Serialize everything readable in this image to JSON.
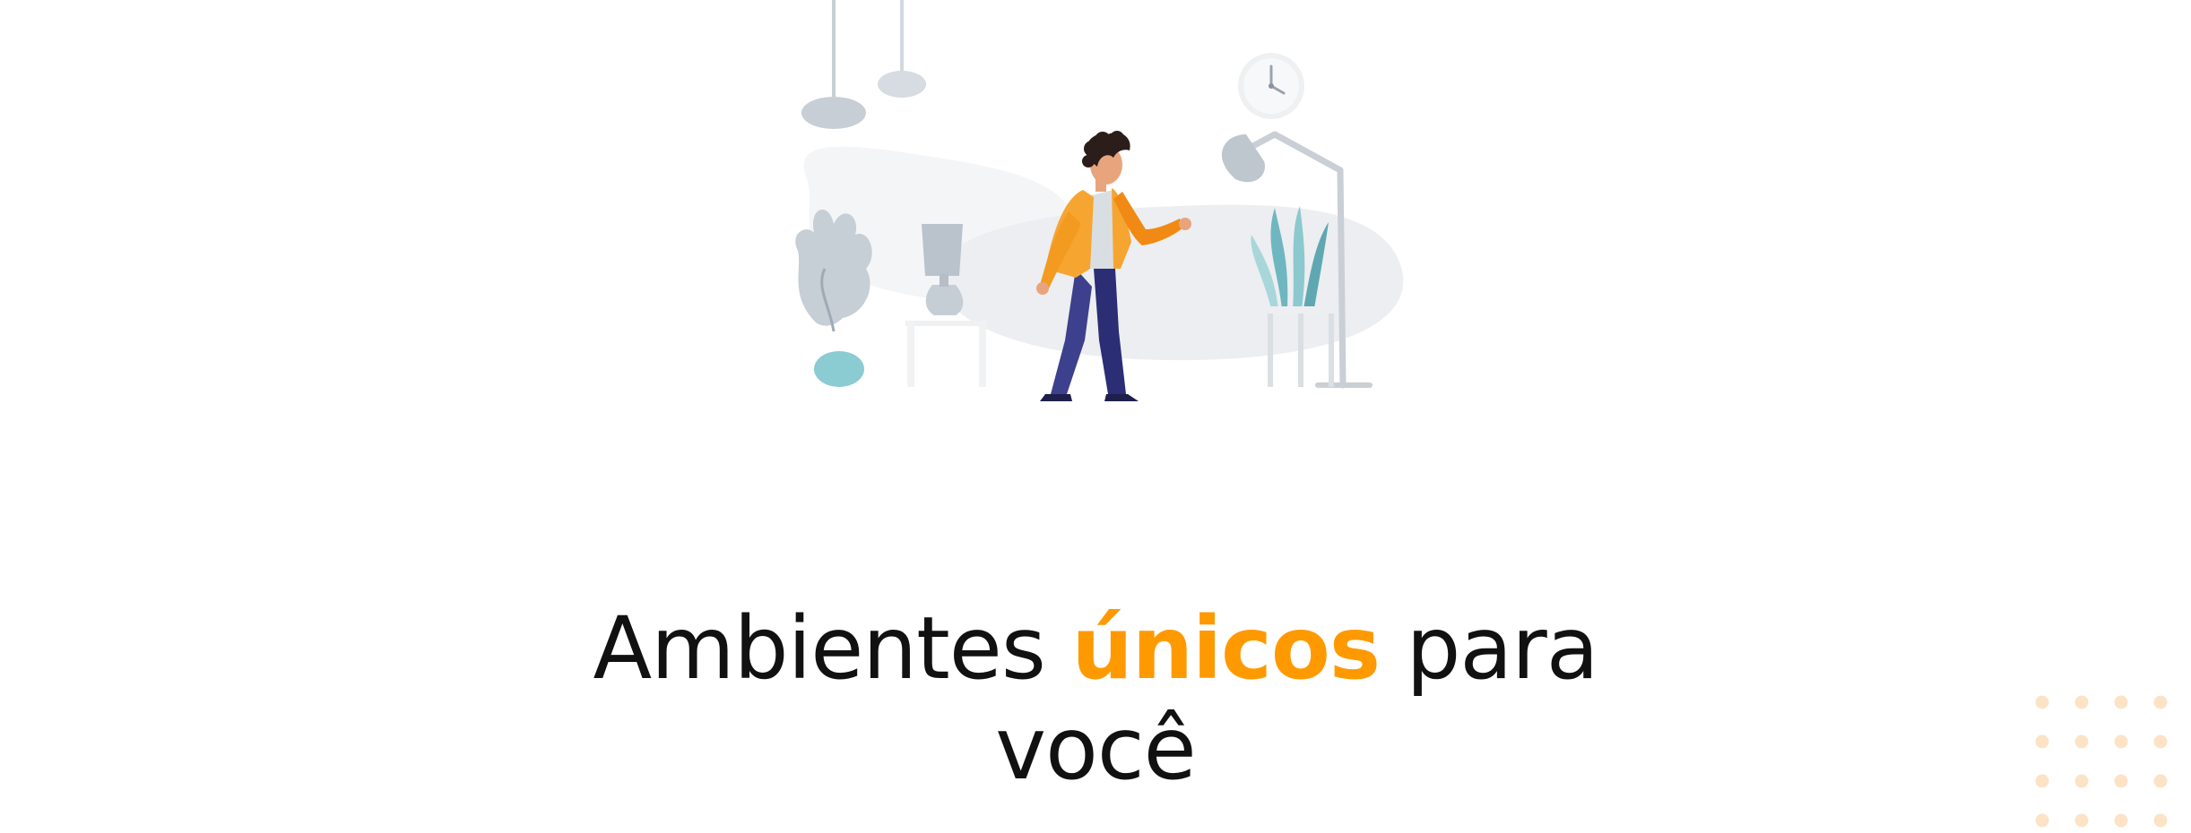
{
  "hero": {
    "illustration": "person-in-living-room-illustration"
  },
  "headline": {
    "prefix": "Ambientes ",
    "highlight": "únicos",
    "suffix_1": " para",
    "suffix_2": "você"
  },
  "colors": {
    "accent": "#FF9900",
    "text": "#111111",
    "dots": "#FCE3C6",
    "illustration_gray": "#C7CED6",
    "illustration_teal": "#7FC4CC",
    "jacket": "#F7A531",
    "pants": "#2B2E75"
  },
  "decor": {
    "dot_grid": "dot-grid-decoration"
  }
}
